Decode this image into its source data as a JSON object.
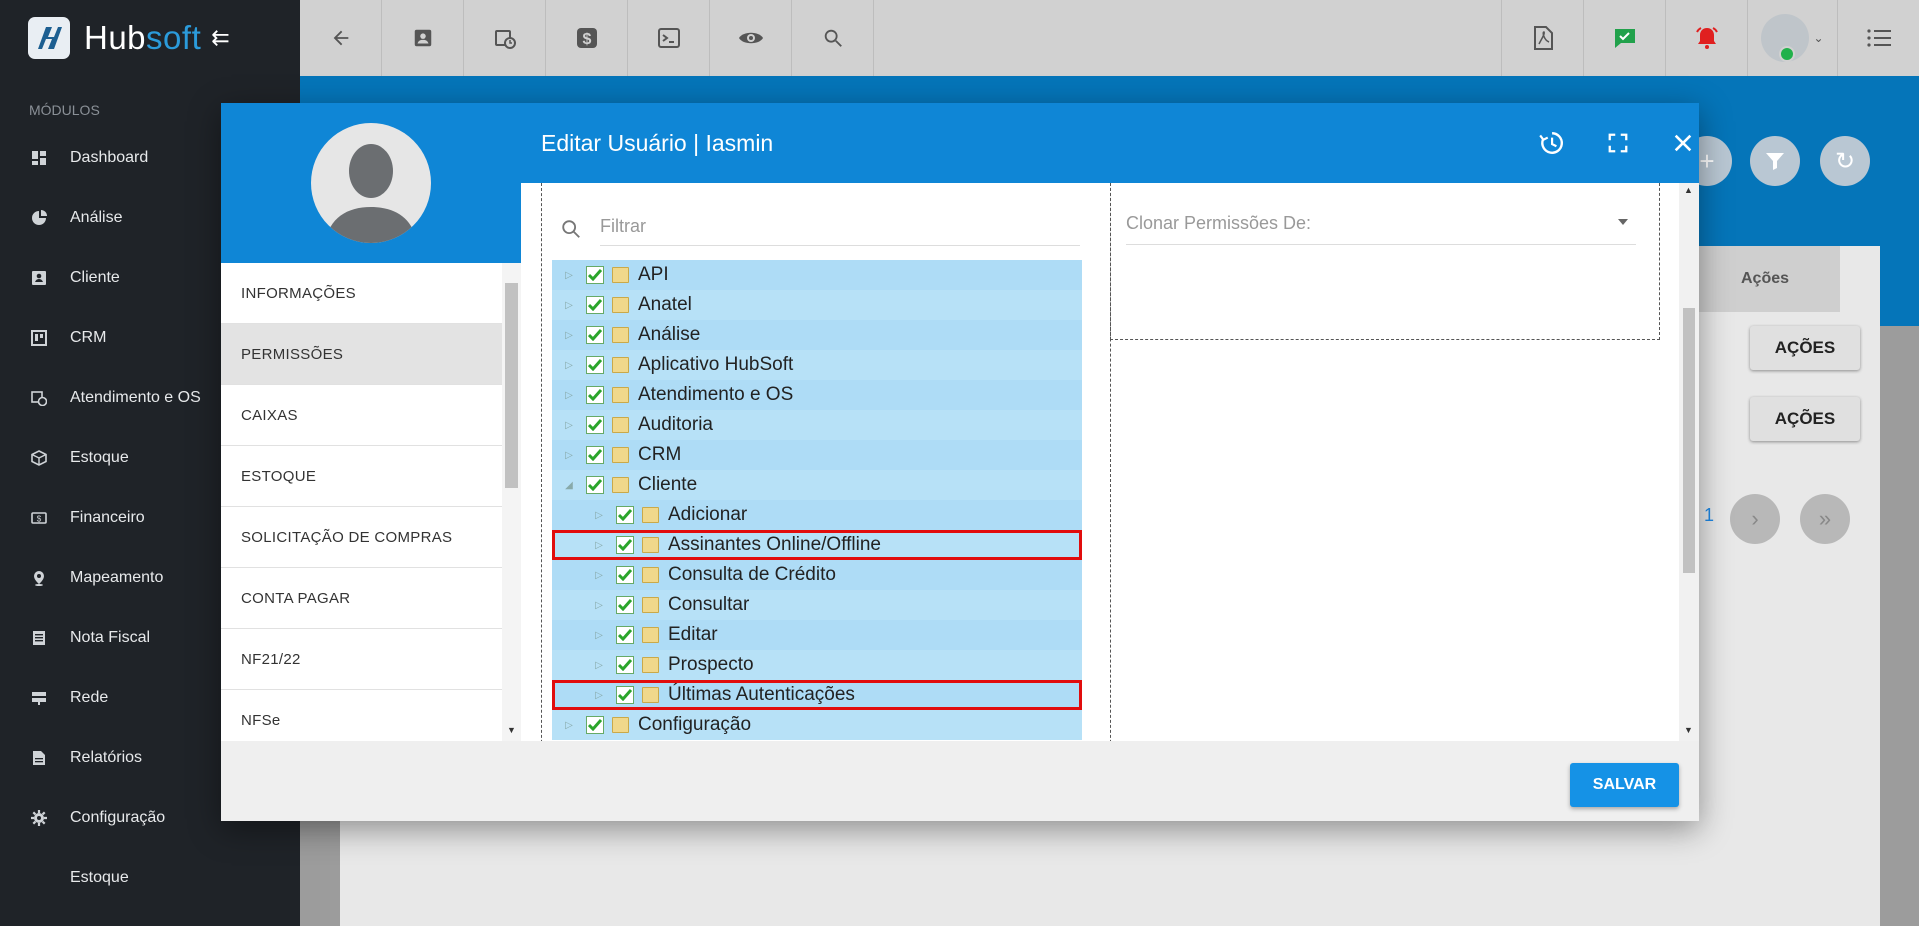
{
  "brand": {
    "name_part1": "Hub",
    "name_part2": "soft"
  },
  "sidebar": {
    "section_label": "MÓDULOS",
    "items": [
      {
        "label": "Dashboard",
        "icon": "dashboard-icon"
      },
      {
        "label": "Análise",
        "icon": "pie-chart-icon"
      },
      {
        "label": "Cliente",
        "icon": "contact-card-icon"
      },
      {
        "label": "CRM",
        "icon": "crm-board-icon"
      },
      {
        "label": "Atendimento e OS",
        "icon": "calendar-clock-icon"
      },
      {
        "label": "Estoque",
        "icon": "box-icon"
      },
      {
        "label": "Financeiro",
        "icon": "money-icon"
      },
      {
        "label": "Mapeamento",
        "icon": "map-pin-icon"
      },
      {
        "label": "Nota Fiscal",
        "icon": "invoice-icon"
      },
      {
        "label": "Rede",
        "icon": "network-icon"
      },
      {
        "label": "Relatórios",
        "icon": "report-icon"
      },
      {
        "label": "Configuração",
        "icon": "gear-icon"
      },
      {
        "label": "Estoque",
        "icon": ""
      }
    ]
  },
  "background": {
    "acoes_header": "Ações",
    "acoes_button": "AÇÕES",
    "pagination_text": ": 1"
  },
  "modal": {
    "title": "Editar Usuário | Iasmin",
    "tabs": [
      "INFORMAÇÕES",
      "PERMISSÕES",
      "CAIXAS",
      "ESTOQUE",
      "SOLICITAÇÃO DE COMPRAS",
      "CONTA PAGAR",
      "NF21/22",
      "NFSe"
    ],
    "active_tab": "PERMISSÕES",
    "filter_placeholder": "Filtrar",
    "clone_placeholder": "Clonar Permissões De:",
    "tree": [
      {
        "label": "API",
        "level": 0,
        "expanded": false,
        "highlighted": false
      },
      {
        "label": "Anatel",
        "level": 0,
        "expanded": false,
        "highlighted": false
      },
      {
        "label": "Análise",
        "level": 0,
        "expanded": false,
        "highlighted": false
      },
      {
        "label": "Aplicativo HubSoft",
        "level": 0,
        "expanded": false,
        "highlighted": false
      },
      {
        "label": "Atendimento e OS",
        "level": 0,
        "expanded": false,
        "highlighted": false
      },
      {
        "label": "Auditoria",
        "level": 0,
        "expanded": false,
        "highlighted": false
      },
      {
        "label": "CRM",
        "level": 0,
        "expanded": false,
        "highlighted": false
      },
      {
        "label": "Cliente",
        "level": 0,
        "expanded": true,
        "highlighted": false
      },
      {
        "label": "Adicionar",
        "level": 1,
        "expanded": false,
        "highlighted": false
      },
      {
        "label": "Assinantes Online/Offline",
        "level": 1,
        "expanded": false,
        "highlighted": true
      },
      {
        "label": "Consulta de Crédito",
        "level": 1,
        "expanded": false,
        "highlighted": false
      },
      {
        "label": "Consultar",
        "level": 1,
        "expanded": false,
        "highlighted": false
      },
      {
        "label": "Editar",
        "level": 1,
        "expanded": false,
        "highlighted": false
      },
      {
        "label": "Prospecto",
        "level": 1,
        "expanded": false,
        "highlighted": false
      },
      {
        "label": "Últimas Autenticações",
        "level": 1,
        "expanded": false,
        "highlighted": true
      },
      {
        "label": "Configuração",
        "level": 0,
        "expanded": false,
        "highlighted": false
      }
    ],
    "save_label": "SALVAR"
  },
  "colors": {
    "sidebar_bg": "#1f2328",
    "header_blue": "#0f86d6",
    "tree_row": "#b7e1f7",
    "highlight_red": "#e10d0d",
    "save_blue": "#1592e6"
  }
}
